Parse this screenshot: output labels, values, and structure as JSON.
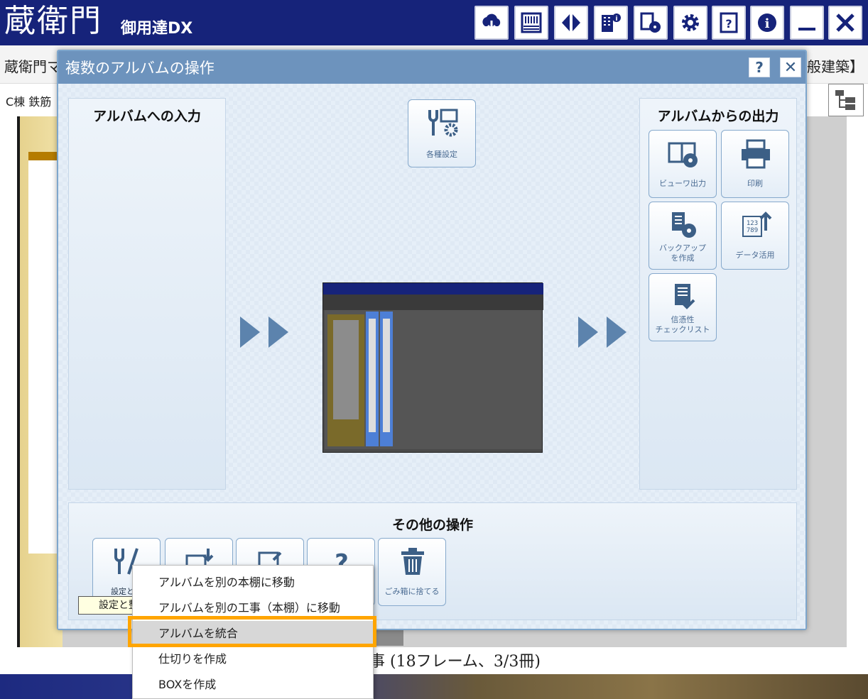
{
  "app": {
    "logo_text": "蔵衛門",
    "logo_sub": "御用達DX",
    "toolbar_icons": [
      "cloud-download-icon",
      "shelf-icon",
      "compare-icon",
      "building-info-icon",
      "disk-output-icon",
      "gear-icon",
      "help-book-icon",
      "info-icon",
      "minimize-icon",
      "close-icon"
    ],
    "subtitle_left": "蔵衛門マ",
    "subtitle_right": "般建築】",
    "location": "C棟  鉄筋",
    "status_text": "事 (18フレーム、3/3冊)"
  },
  "dialog": {
    "title": "複数のアルバムの操作",
    "help_label": "?",
    "close_label": "✕",
    "input_panel_title": "アルバムへの入力",
    "output_panel_title": "アルバムからの出力",
    "settings_button": "各種設定",
    "output_buttons": [
      {
        "label": "ビューワ出力",
        "icon": "viewer-output-icon"
      },
      {
        "label": "印刷",
        "icon": "printer-icon"
      },
      {
        "label": "バックアップ\nを作成",
        "icon": "backup-icon"
      },
      {
        "label": "データ活用",
        "icon": "data-export-icon"
      },
      {
        "label": "信憑性\nチェックリスト",
        "icon": "checklist-icon"
      }
    ],
    "other_ops_title": "その他の操作",
    "other_buttons": [
      {
        "label": "設定と整",
        "icon": "tools-icon"
      },
      {
        "label": "",
        "icon": "shelf-move-icon"
      },
      {
        "label": "",
        "icon": "album-export-icon"
      },
      {
        "label": "",
        "icon": "help-icon"
      },
      {
        "label": "ごみ箱に捨てる",
        "icon": "trash-icon"
      }
    ]
  },
  "tooltip": "設定と整",
  "context_menu": {
    "items": [
      {
        "label": "アルバムを別の本棚に移動"
      },
      {
        "label": "アルバムを別の工事（本棚）に移動"
      },
      {
        "label": "アルバムを統合",
        "selected": true
      },
      {
        "label": "仕切りを作成"
      },
      {
        "label": "BOXを作成"
      }
    ],
    "highlight_color": "#ffa500"
  },
  "colors": {
    "topbar": "#16237a",
    "dialog_title": "#6d93bd",
    "accent": "#5c83ad"
  }
}
